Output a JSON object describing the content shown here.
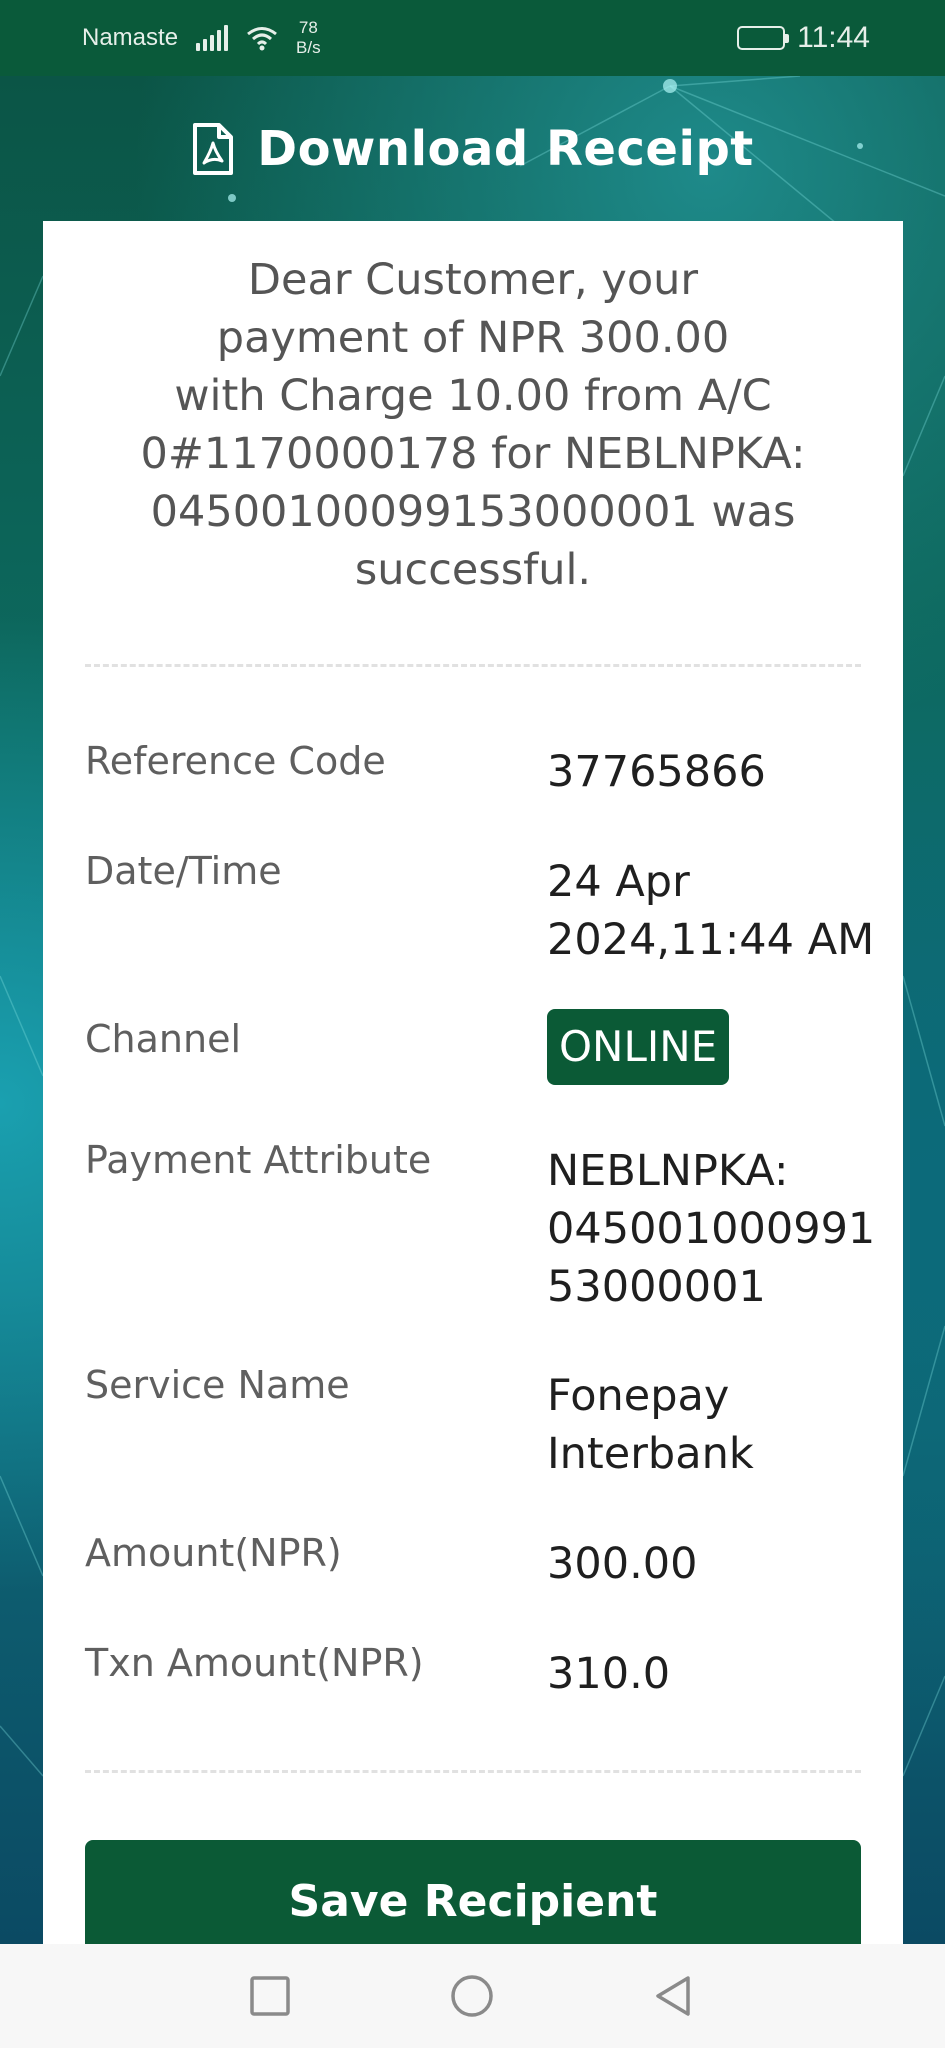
{
  "status_bar": {
    "carrier": "Namaste",
    "net_speed_value": "78",
    "net_speed_unit": "B/s",
    "time": "11:44",
    "battery_level": 1.0
  },
  "header": {
    "title": "Download Receipt",
    "icon": "pdf-file-icon"
  },
  "receipt": {
    "message_lines": [
      "Dear Customer, your",
      "payment of NPR 300.00",
      "with Charge 10.00 from A/C",
      "0#1170000178 for NEBLNPKA:",
      "045001000991530000​01 was",
      "successful."
    ],
    "rows": [
      {
        "label": "Reference Code",
        "value": "37765866"
      },
      {
        "label": "Date/Time",
        "value_lines": [
          "24 Apr",
          "2024,11:44 AM"
        ]
      },
      {
        "label": "Channel",
        "value": "ONLINE"
      },
      {
        "label": "Payment Attribute",
        "value_lines": [
          "NEBLNPKA:",
          "045001000991",
          "53000001"
        ]
      },
      {
        "label": "Service Name",
        "value_lines": [
          "Fonepay",
          "Interbank"
        ]
      },
      {
        "label": "Amount(NPR)",
        "value": "300.00"
      },
      {
        "label": "Txn Amount(NPR)",
        "value": "310.0"
      }
    ],
    "action_button": "Save Recipient"
  },
  "navigation": {
    "recent": "square-icon",
    "home": "circle-icon",
    "back": "triangle-back-icon"
  },
  "colors": {
    "brand_green": "#0b5a36",
    "status_bar": "#0a5a3a"
  }
}
